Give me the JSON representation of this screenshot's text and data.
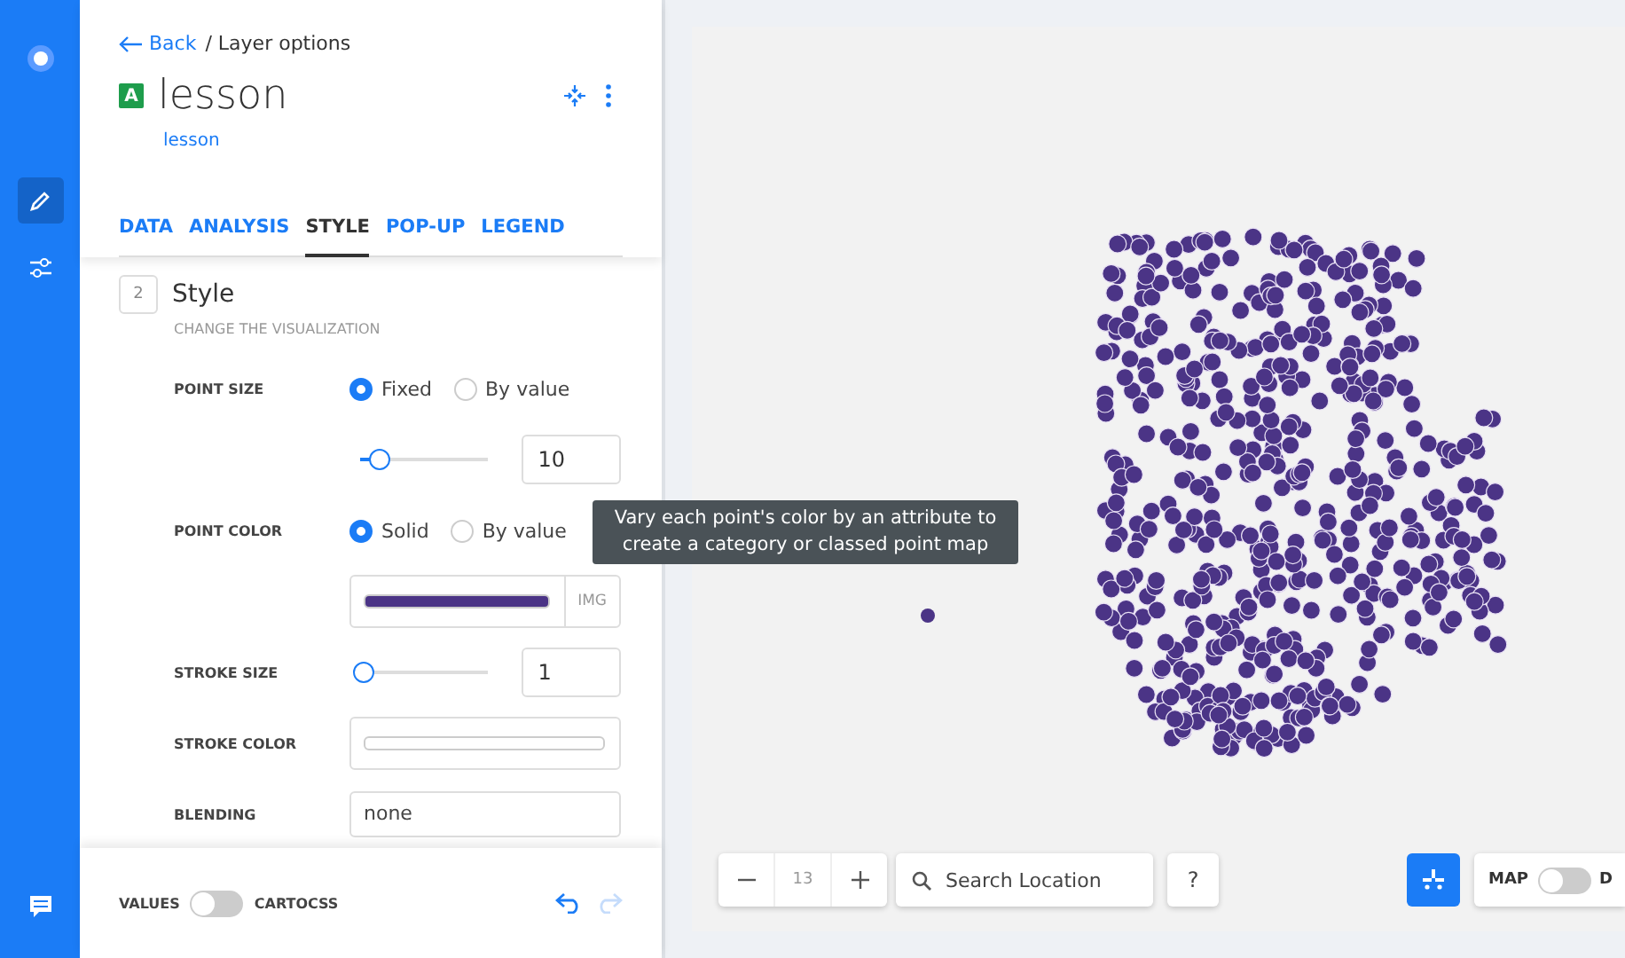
{
  "rail": {
    "items": [
      {
        "kind": "logo",
        "selected": false
      },
      {
        "kind": "edit",
        "selected": true
      },
      {
        "kind": "filters",
        "selected": false
      },
      {
        "kind": "chat",
        "selected": false
      }
    ]
  },
  "header": {
    "back": "Back",
    "breadcrumb": "/ Layer options",
    "badge": "A",
    "title": "lesson",
    "subtitle": "lesson"
  },
  "tabs": [
    {
      "label": "DATA",
      "selected": false
    },
    {
      "label": "ANALYSIS",
      "selected": false
    },
    {
      "label": "STYLE",
      "selected": true
    },
    {
      "label": "POP-UP",
      "selected": false
    },
    {
      "label": "LEGEND",
      "selected": false
    }
  ],
  "section": {
    "number": "2",
    "title": "Style",
    "subtitle": "CHANGE THE VISUALIZATION"
  },
  "rows": [
    {
      "kind": "radio",
      "label": "POINT SIZE",
      "options": [
        {
          "label": "Fixed",
          "selected": true
        },
        {
          "label": "By value",
          "selected": false
        }
      ]
    },
    {
      "kind": "slider",
      "level": 0.12,
      "value": "10"
    },
    {
      "kind": "radio",
      "label": "POINT COLOR",
      "options": [
        {
          "label": "Solid",
          "selected": true
        },
        {
          "label": "By value",
          "selected": false
        }
      ]
    },
    {
      "kind": "color",
      "color": "#4b3486",
      "button": "IMG"
    },
    {
      "kind": "slider",
      "label": "STROKE SIZE",
      "level": 0.02,
      "value": "1"
    },
    {
      "kind": "color",
      "label": "STROKE COLOR",
      "color": "#ffffff"
    },
    {
      "kind": "select",
      "label": "BLENDING",
      "value": "none"
    }
  ],
  "tooltip": "Vary each point's color by an attribute to create a category or classed point map",
  "footer": {
    "left_label": "VALUES",
    "on": false,
    "right_label": "CARTOCSS",
    "redo_disabled": true
  },
  "map": {
    "zoom": "13",
    "search_placeholder": "Search Location",
    "help": "?",
    "toggle_label": "MAP",
    "toggle_on": false,
    "toggle_right": "D"
  }
}
